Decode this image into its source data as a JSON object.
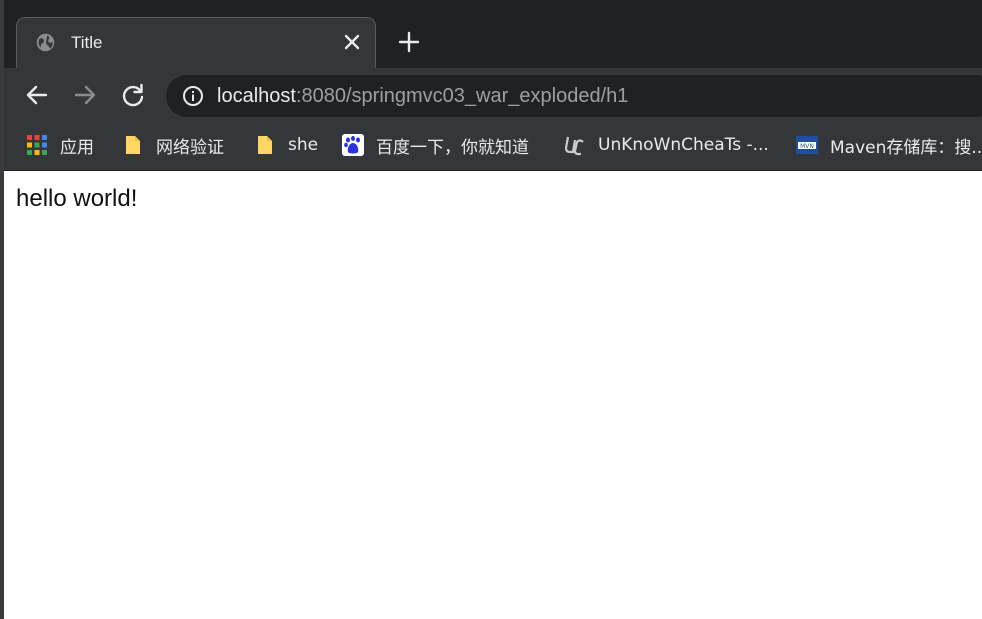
{
  "tab": {
    "title": "Title",
    "favicon": "globe-icon",
    "close": "close-icon"
  },
  "new_tab": "plus-icon",
  "toolbar": {
    "back": "arrow-left-icon",
    "forward": "arrow-right-icon",
    "reload": "reload-icon",
    "site_info": "info-icon",
    "url_host": "localhost",
    "url_rest": ":8080/springmvc03_war_exploded/h1"
  },
  "bookmarks": [
    {
      "label": "应用",
      "icon": "apps-grid-icon"
    },
    {
      "label": "网络验证",
      "icon": "folder-icon"
    },
    {
      "label": "she",
      "icon": "folder-icon"
    },
    {
      "label": "百度一下，你就知道",
      "icon": "baidu-paw-icon"
    },
    {
      "label": "UnKnoWnCheaTs -...",
      "icon": "uc-logo-icon"
    },
    {
      "label": "Maven存储库：搜...",
      "icon": "maven-icon"
    }
  ],
  "page": {
    "body_text": "hello world!"
  },
  "colors": {
    "tabstrip": "#202124",
    "toolbar": "#35363a",
    "omnibox": "#202124",
    "text_light": "#e8eaed",
    "text_dim": "#9aa0a6"
  }
}
